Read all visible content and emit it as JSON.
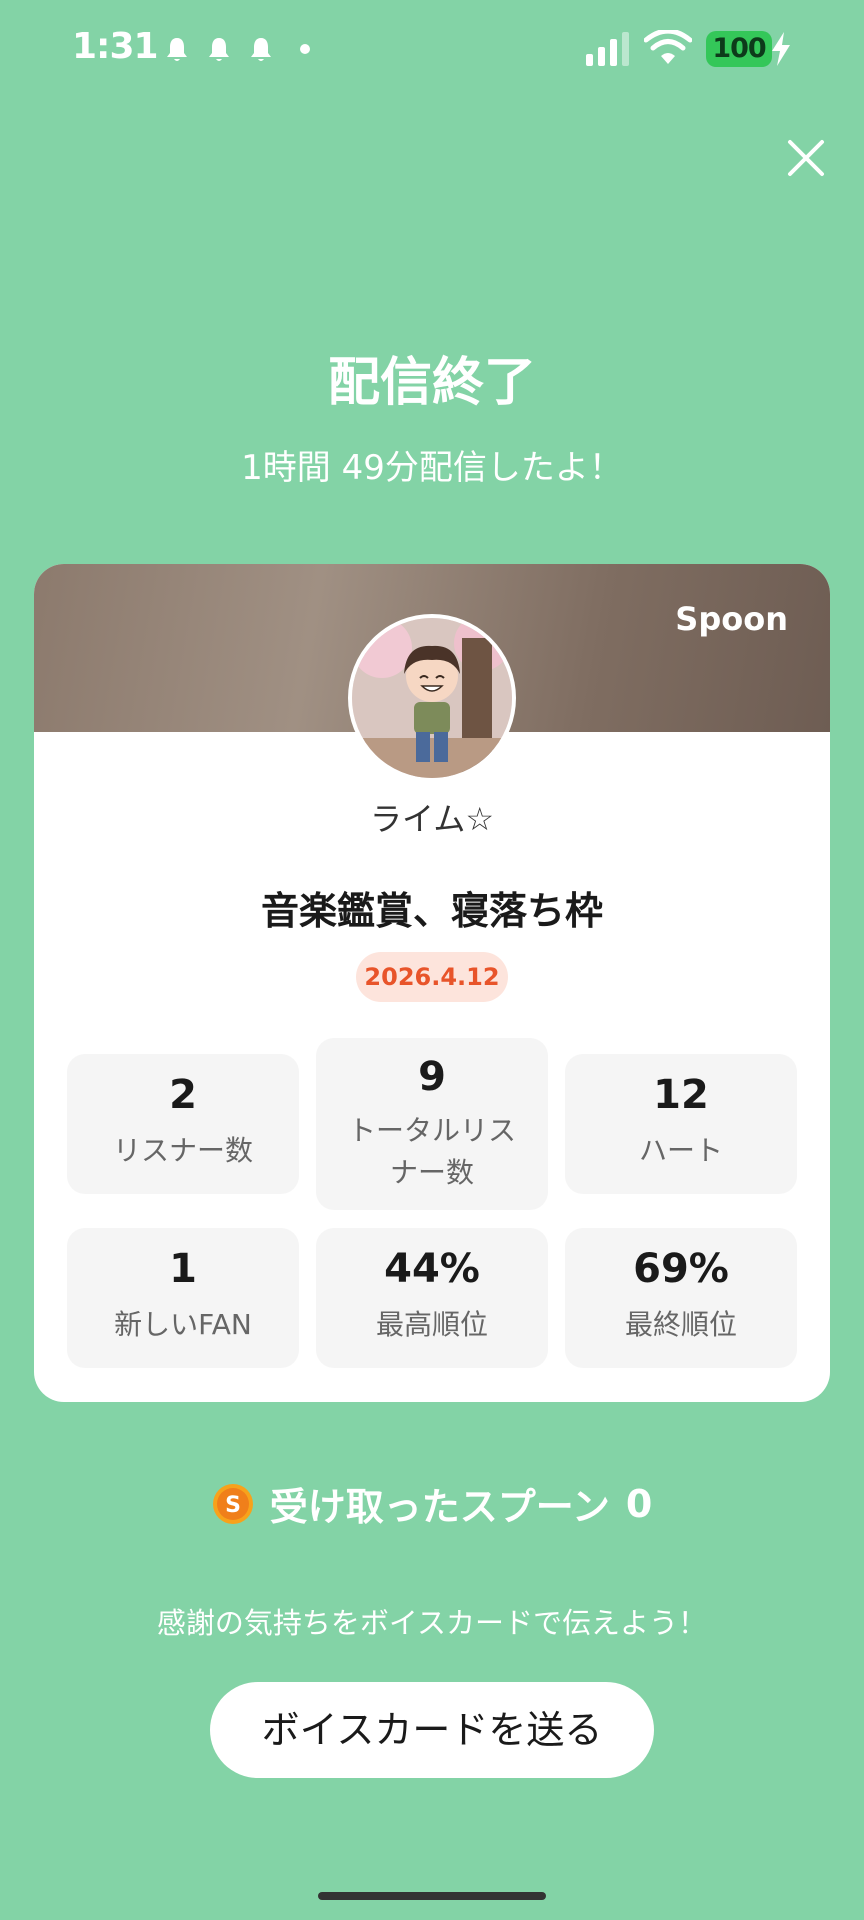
{
  "status_bar": {
    "time": "1:31",
    "battery": "100",
    "icons": [
      "notification-bell-icon",
      "notification-bell-icon",
      "notification-bell-icon",
      "dot-icon",
      "signal-icon",
      "wifi-icon",
      "charging-bolt-icon"
    ]
  },
  "header": {
    "title": "配信終了",
    "subtitle": "1時間 49分配信したよ！",
    "close_icon": "close-icon"
  },
  "card": {
    "brand": "Spoon",
    "username": "ライム☆",
    "live_title": "音楽鑑賞、寝落ち枠",
    "date": "2026.4.12",
    "stats": [
      {
        "value": "2",
        "label": "リスナー数"
      },
      {
        "value": "9",
        "label": "トータルリスナー数"
      },
      {
        "value": "12",
        "label": "ハート"
      },
      {
        "value": "1",
        "label": "新しいFAN"
      },
      {
        "value": "44%",
        "label": "最高順位"
      },
      {
        "value": "69%",
        "label": "最終順位"
      }
    ]
  },
  "spoons": {
    "icon": "spoon-coin-icon",
    "label": "受け取ったスプーン",
    "count": "0"
  },
  "thanks_text": "感謝の気持ちをボイスカードで伝えよう！",
  "voice_card_button": "ボイスカードを送る",
  "colors": {
    "background": "#83d3a6",
    "badge_text": "#e8542a",
    "badge_bg": "#fde4dc",
    "battery": "#34c759"
  }
}
